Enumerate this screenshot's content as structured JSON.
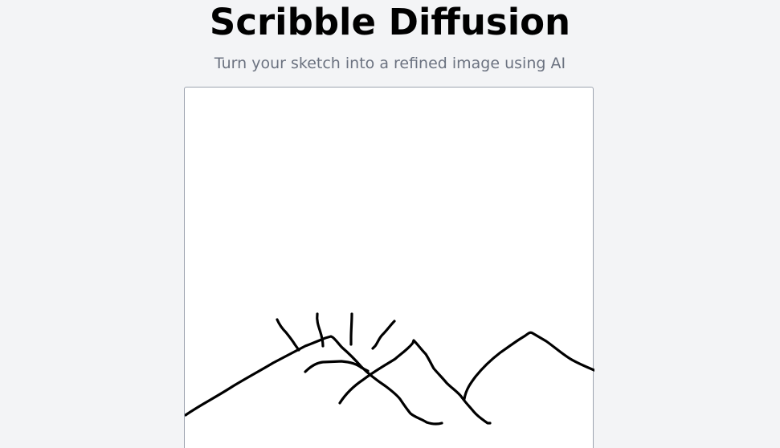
{
  "header": {
    "title": "Scribble Diffusion",
    "subtitle": "Turn your sketch into a refined image using AI"
  },
  "canvas": {
    "background": "#ffffff",
    "stroke_color": "#000000"
  }
}
